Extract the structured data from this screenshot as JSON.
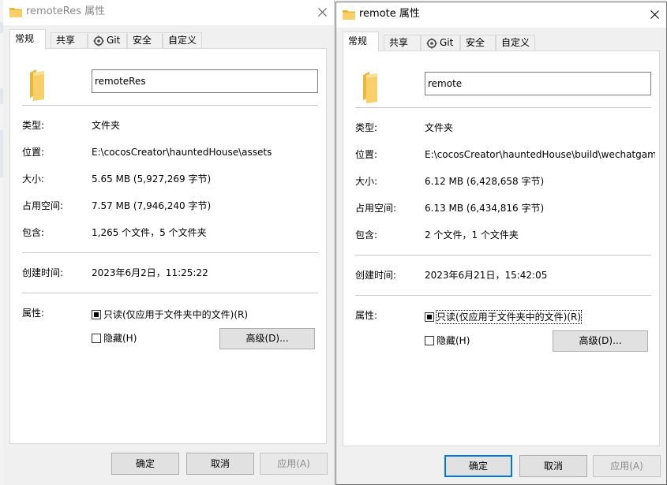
{
  "left_window": {
    "title": "remoteRes 属性",
    "tabs": [
      "常规",
      "共享",
      "Git",
      "安全",
      "自定义"
    ],
    "name_value": "remoteRes",
    "fields": {
      "type_label": "类型:",
      "type_value": "文件夹",
      "location_label": "位置:",
      "location_value": "E:\\cocosCreator\\hauntedHouse\\assets",
      "size_label": "大小:",
      "size_value": "5.65 MB (5,927,269 字节)",
      "disk_label": "占用空间:",
      "disk_value": "7.57 MB (7,946,240 字节)",
      "contains_label": "包含:",
      "contains_value": "1,265 个文件，5 个文件夹",
      "created_label": "创建时间:",
      "created_value": "2023年6月2日，11:25:22",
      "attributes_label": "属性:"
    },
    "readonly_label": "只读(仅应用于文件夹中的文件)(R)",
    "hidden_label": "隐藏(H)",
    "advanced_label": "高级(D)...",
    "ok_label": "确定",
    "cancel_label": "取消",
    "apply_label": "应用(A)"
  },
  "right_window": {
    "title": "remote 属性",
    "tabs": [
      "常规",
      "共享",
      "Git",
      "安全",
      "自定义"
    ],
    "name_value": "remote",
    "fields": {
      "type_label": "类型:",
      "type_value": "文件夹",
      "location_label": "位置:",
      "location_value": "E:\\cocosCreator\\hauntedHouse\\build\\wechatgam",
      "size_label": "大小:",
      "size_value": "6.12 MB (6,428,658 字节)",
      "disk_label": "占用空间:",
      "disk_value": "6.13 MB (6,434,816 字节)",
      "contains_label": "包含:",
      "contains_value": "2 个文件，1 个文件夹",
      "created_label": "创建时间:",
      "created_value": "2023年6月21日，15:42:05",
      "attributes_label": "属性:"
    },
    "readonly_label": "只读(仅应用于文件夹中的文件)(R)",
    "hidden_label": "隐藏(H)",
    "advanced_label": "高级(D)...",
    "ok_label": "确定",
    "cancel_label": "取消",
    "apply_label": "应用(A)"
  },
  "colors": {
    "folder": "#f5c342",
    "accent": "#0078d7"
  },
  "icons": [
    "folder-icon",
    "close-icon",
    "git-icon"
  ]
}
